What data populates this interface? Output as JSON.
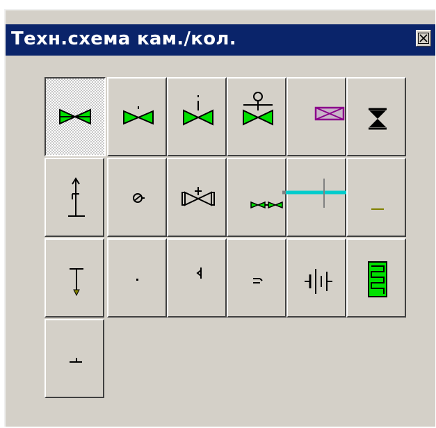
{
  "window": {
    "title": "Техн.схема кам./кол.",
    "close_icon": "close-x-icon"
  },
  "palette": {
    "pressed_tool": "valve",
    "tools": [
      {
        "id": "valve",
        "icon": "gate-valve-icon",
        "row": 1,
        "col": 1
      },
      {
        "id": "valve-actuated",
        "icon": "valve-with-stem-icon",
        "row": 1,
        "col": 2
      },
      {
        "id": "valve-manual",
        "icon": "valve-manual-stem-icon",
        "row": 1,
        "col": 3
      },
      {
        "id": "valve-electric",
        "icon": "valve-electric-drive-icon",
        "row": 1,
        "col": 4
      },
      {
        "id": "box",
        "icon": "crossed-box-icon",
        "row": 1,
        "col": 5
      },
      {
        "id": "hourglass",
        "icon": "hourglass-valve-icon",
        "row": 1,
        "col": 6
      },
      {
        "id": "hydrant",
        "icon": "hydrant-icon",
        "row": 2,
        "col": 1
      },
      {
        "id": "gauge",
        "icon": "gauge-icon",
        "row": 2,
        "col": 2
      },
      {
        "id": "valve-bracket",
        "icon": "bracketed-valve-icon",
        "row": 2,
        "col": 3
      },
      {
        "id": "valve-double",
        "icon": "double-valve-icon",
        "row": 2,
        "col": 4
      },
      {
        "id": "pipe",
        "icon": "pipe-cross-icon",
        "row": 2,
        "col": 5
      },
      {
        "id": "line",
        "icon": "line-segment-icon",
        "row": 2,
        "col": 6
      },
      {
        "id": "tap",
        "icon": "tap-icon",
        "row": 3,
        "col": 1
      },
      {
        "id": "dot",
        "icon": "dot-icon",
        "row": 3,
        "col": 2
      },
      {
        "id": "hook",
        "icon": "hook-icon",
        "row": 3,
        "col": 3
      },
      {
        "id": "transition",
        "icon": "transition-icon",
        "row": 3,
        "col": 4
      },
      {
        "id": "flange",
        "icon": "flange-icon",
        "row": 3,
        "col": 5
      },
      {
        "id": "heater",
        "icon": "heater-coil-icon",
        "row": 3,
        "col": 6
      },
      {
        "id": "junction",
        "icon": "junction-icon",
        "row": 4,
        "col": 1
      }
    ]
  }
}
